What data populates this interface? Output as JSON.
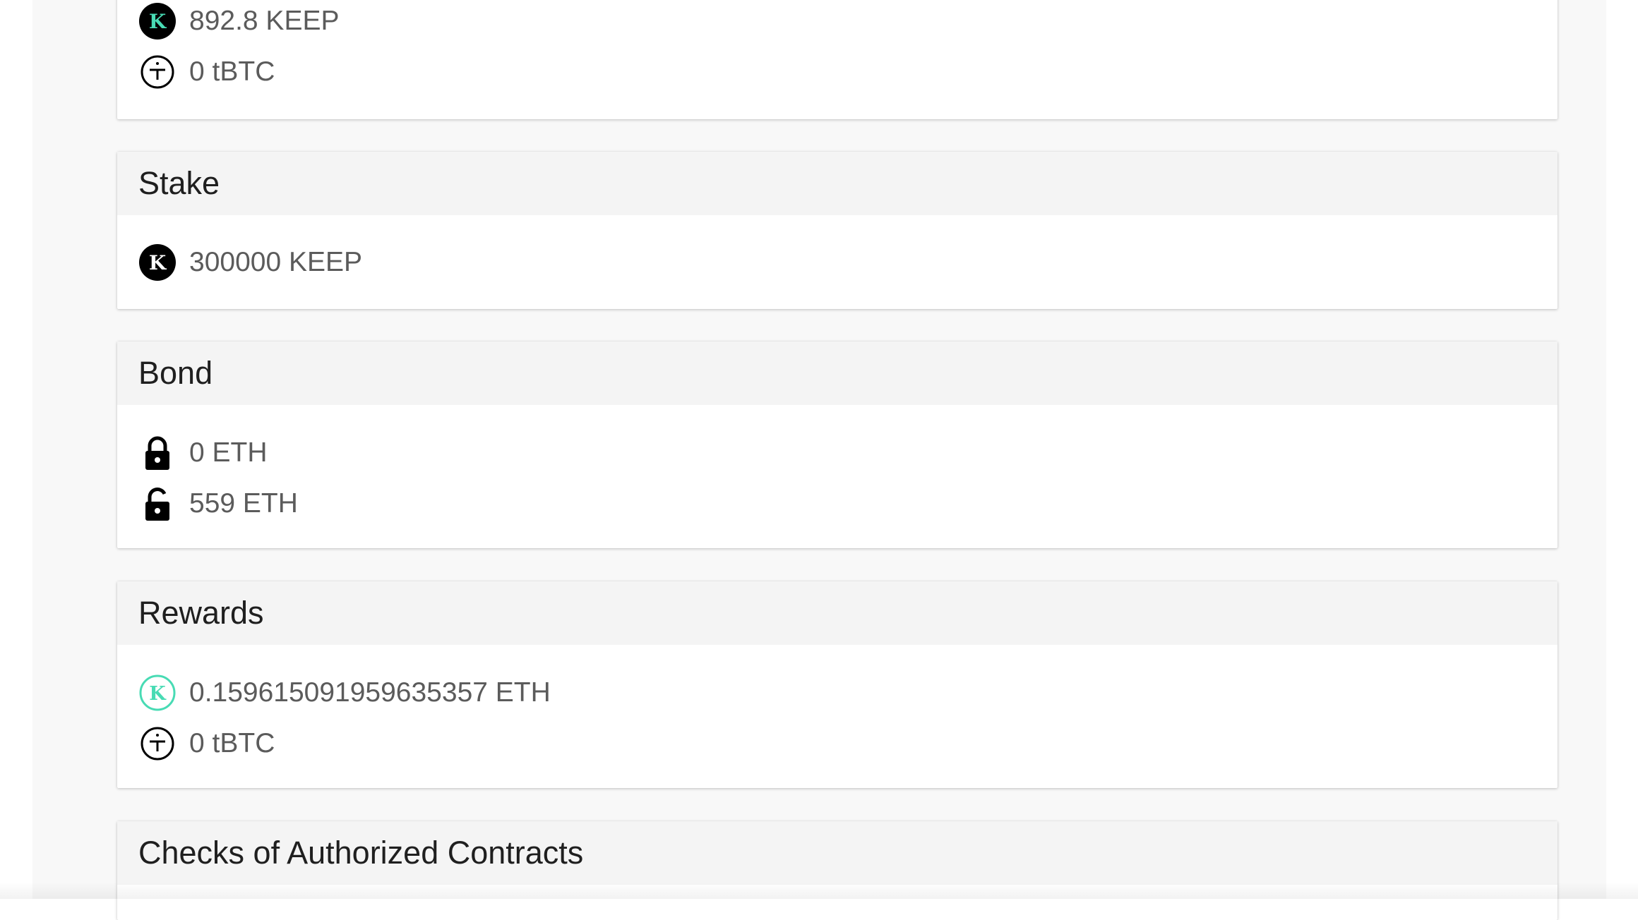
{
  "balance": {
    "rows": [
      {
        "icon": "keep-token-icon",
        "value": "892.8 KEEP"
      },
      {
        "icon": "tbtc-token-icon",
        "value": "0 tBTC"
      }
    ]
  },
  "stake": {
    "title": "Stake",
    "rows": [
      {
        "icon": "keep-token-icon",
        "value": "300000 KEEP"
      }
    ]
  },
  "bond": {
    "title": "Bond",
    "rows": [
      {
        "icon": "lock-icon",
        "value": "0 ETH"
      },
      {
        "icon": "unlock-icon",
        "value": "559 ETH"
      }
    ]
  },
  "rewards": {
    "title": "Rewards",
    "rows": [
      {
        "icon": "keep-outline-icon",
        "value": "0.159615091959635357 ETH"
      },
      {
        "icon": "tbtc-token-icon",
        "value": "0 tBTC"
      }
    ]
  },
  "checks": {
    "title": "Checks of Authorized Contracts"
  },
  "colors": {
    "keep_accent": "#48dbb4",
    "icon_dark": "#000000",
    "header_bg": "#f4f4f4",
    "page_bg": "#f8f8f8"
  }
}
